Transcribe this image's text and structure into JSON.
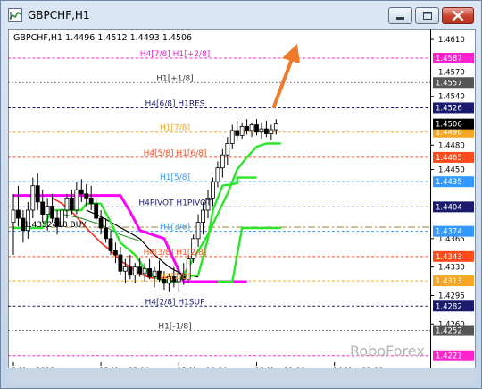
{
  "window": {
    "title": "GBPCHF,H1",
    "header_info": "GBPCHF,H1  1.4496 1.4512 1.4493 1.4506",
    "watermark": "RoboForex",
    "controls": [
      "minimize",
      "maximize",
      "close"
    ]
  },
  "chart_data": {
    "type": "candlestick",
    "symbol": "GBPCHF",
    "timeframe": "H1",
    "ohlc_header": {
      "open": 1.4496,
      "high": 1.4512,
      "low": 1.4493,
      "close": 1.4506
    },
    "ylim": [
      1.4213,
      1.462
    ],
    "price_ticks": [
      1.461,
      1.457,
      1.454,
      1.448,
      1.445,
      1.4365,
      1.433,
      1.4295,
      1.426
    ],
    "price_tick_labels": [
      "1.4610",
      "1.4570",
      "1.4540",
      "1.4480",
      "1.4450",
      "1.4365",
      "1.4330",
      "1.4295",
      "1.4260"
    ],
    "x_tick_labels": [
      "9 Mar 2012",
      "12 Mar 03:00",
      "12 Mar 19:00",
      "13 Mar 11:00",
      "14 Mar 03:00"
    ],
    "x_tick_index": [
      0,
      18,
      34,
      50,
      66
    ],
    "levels": [
      {
        "label": "H4[7/8] H1[+2/8]",
        "price": 1.4587,
        "price_label": "1.4587",
        "color": "#ff22cc",
        "style": "dash",
        "label_color": "#ee22cc"
      },
      {
        "label": "H1[+1/8]",
        "price": 1.4557,
        "price_label": "1.4557",
        "color": "#555555",
        "style": "dot",
        "label_color": "#333333"
      },
      {
        "label": "H4[6/8] H1RES",
        "price": 1.4526,
        "price_label": "1.4526",
        "color": "#1a1a6e",
        "style": "dash",
        "label_color": "#1a1a6e"
      },
      {
        "label": "H1[7/8]",
        "price": 1.4496,
        "price_label": "1.4496",
        "color": "#f5a623",
        "style": "dash",
        "label_color": "#f5a623"
      },
      {
        "label": "H4[5/8] H1[6/8]",
        "price": 1.4465,
        "price_label": "1.4465",
        "color": "#ff4a1c",
        "style": "dash",
        "label_color": "#ff4a1c"
      },
      {
        "label": "H1[5/8]",
        "price": 1.4435,
        "price_label": "1.4435",
        "color": "#3399ff",
        "style": "dash",
        "label_color": "#3399ff"
      },
      {
        "label": "H4PIVOT H1PIVOT",
        "price": 1.4404,
        "price_label": "1.4404",
        "color": "#1a1a6e",
        "style": "dash",
        "label_color": "#1a1a6e"
      },
      {
        "label": "H1[3/8]",
        "price": 1.4374,
        "price_label": "1.4374",
        "color": "#3399ff",
        "style": "dash",
        "label_color": "#3399ff"
      },
      {
        "label": "H4[3/8] H1[2/8]",
        "price": 1.4343,
        "price_label": "1.4343",
        "color": "#ff4a1c",
        "style": "dash",
        "label_color": "#ff4a1c"
      },
      {
        "label": "H1[1/8]",
        "price": 1.4313,
        "price_label": "1.4313",
        "color": "#f5a623",
        "style": "dash",
        "label_color": "#f5a623"
      },
      {
        "label": "H4[2/8] H1SUP",
        "price": 1.4282,
        "price_label": "1.4282",
        "color": "#1a1a6e",
        "style": "dash",
        "label_color": "#1a1a6e"
      },
      {
        "label": "H1[-1/8]",
        "price": 1.4252,
        "price_label": "1.4252",
        "color": "#555555",
        "style": "dot",
        "label_color": "#333333"
      },
      {
        "label": "",
        "price": 1.4221,
        "price_label": "1.4221",
        "color": "#ff22cc",
        "style": "dash",
        "label_color": "#ee22cc"
      }
    ],
    "current_price": {
      "value": 1.4506,
      "label": "1.4506",
      "color": "#000000"
    },
    "ask_line": {
      "price": 1.4379,
      "color": "#b5a26a",
      "style": "dashdot"
    },
    "left_label": {
      "text": "1.4352418 BUY",
      "price": 1.4385
    },
    "candles": [
      {
        "o": 1.4385,
        "h": 1.442,
        "l": 1.4345,
        "c": 1.44
      },
      {
        "o": 1.44,
        "h": 1.443,
        "l": 1.438,
        "c": 1.439
      },
      {
        "o": 1.439,
        "h": 1.44,
        "l": 1.436,
        "c": 1.4375
      },
      {
        "o": 1.4375,
        "h": 1.441,
        "l": 1.4365,
        "c": 1.44
      },
      {
        "o": 1.44,
        "h": 1.444,
        "l": 1.439,
        "c": 1.443
      },
      {
        "o": 1.443,
        "h": 1.4445,
        "l": 1.44,
        "c": 1.441
      },
      {
        "o": 1.441,
        "h": 1.4425,
        "l": 1.4385,
        "c": 1.4395
      },
      {
        "o": 1.4395,
        "h": 1.4415,
        "l": 1.4375,
        "c": 1.4405
      },
      {
        "o": 1.4405,
        "h": 1.442,
        "l": 1.4385,
        "c": 1.439
      },
      {
        "o": 1.439,
        "h": 1.44,
        "l": 1.437,
        "c": 1.438
      },
      {
        "o": 1.438,
        "h": 1.441,
        "l": 1.4375,
        "c": 1.44
      },
      {
        "o": 1.44,
        "h": 1.442,
        "l": 1.439,
        "c": 1.4415
      },
      {
        "o": 1.4415,
        "h": 1.4425,
        "l": 1.4395,
        "c": 1.44
      },
      {
        "o": 1.44,
        "h": 1.4435,
        "l": 1.4395,
        "c": 1.4425
      },
      {
        "o": 1.4425,
        "h": 1.4438,
        "l": 1.441,
        "c": 1.442
      },
      {
        "o": 1.442,
        "h": 1.4432,
        "l": 1.4405,
        "c": 1.4415
      },
      {
        "o": 1.4415,
        "h": 1.443,
        "l": 1.44,
        "c": 1.4408
      },
      {
        "o": 1.4408,
        "h": 1.4415,
        "l": 1.4385,
        "c": 1.439
      },
      {
        "o": 1.439,
        "h": 1.44,
        "l": 1.437,
        "c": 1.4378
      },
      {
        "o": 1.4378,
        "h": 1.439,
        "l": 1.436,
        "c": 1.4365
      },
      {
        "o": 1.4365,
        "h": 1.4375,
        "l": 1.4345,
        "c": 1.435
      },
      {
        "o": 1.435,
        "h": 1.436,
        "l": 1.4335,
        "c": 1.4345
      },
      {
        "o": 1.4345,
        "h": 1.4355,
        "l": 1.432,
        "c": 1.4325
      },
      {
        "o": 1.4325,
        "h": 1.434,
        "l": 1.431,
        "c": 1.433
      },
      {
        "o": 1.433,
        "h": 1.4345,
        "l": 1.4315,
        "c": 1.432
      },
      {
        "o": 1.432,
        "h": 1.4335,
        "l": 1.431,
        "c": 1.433
      },
      {
        "o": 1.433,
        "h": 1.4342,
        "l": 1.4318,
        "c": 1.4322
      },
      {
        "o": 1.4322,
        "h": 1.4335,
        "l": 1.4312,
        "c": 1.4328
      },
      {
        "o": 1.4328,
        "h": 1.434,
        "l": 1.4315,
        "c": 1.4318
      },
      {
        "o": 1.4318,
        "h": 1.433,
        "l": 1.4305,
        "c": 1.4325
      },
      {
        "o": 1.4325,
        "h": 1.4338,
        "l": 1.4312,
        "c": 1.4315
      },
      {
        "o": 1.4315,
        "h": 1.4325,
        "l": 1.4302,
        "c": 1.431
      },
      {
        "o": 1.431,
        "h": 1.4322,
        "l": 1.43,
        "c": 1.4318
      },
      {
        "o": 1.4318,
        "h": 1.433,
        "l": 1.4305,
        "c": 1.4312
      },
      {
        "o": 1.4312,
        "h": 1.4328,
        "l": 1.43,
        "c": 1.4322
      },
      {
        "o": 1.4322,
        "h": 1.4335,
        "l": 1.4308,
        "c": 1.4315
      },
      {
        "o": 1.4315,
        "h": 1.4345,
        "l": 1.431,
        "c": 1.434
      },
      {
        "o": 1.434,
        "h": 1.437,
        "l": 1.4335,
        "c": 1.4365
      },
      {
        "o": 1.4365,
        "h": 1.4395,
        "l": 1.4355,
        "c": 1.4385
      },
      {
        "o": 1.4385,
        "h": 1.441,
        "l": 1.437,
        "c": 1.44
      },
      {
        "o": 1.44,
        "h": 1.4425,
        "l": 1.439,
        "c": 1.4415
      },
      {
        "o": 1.4415,
        "h": 1.444,
        "l": 1.4405,
        "c": 1.4435
      },
      {
        "o": 1.4435,
        "h": 1.446,
        "l": 1.4428,
        "c": 1.4452
      },
      {
        "o": 1.4452,
        "h": 1.4475,
        "l": 1.444,
        "c": 1.4468
      },
      {
        "o": 1.4468,
        "h": 1.449,
        "l": 1.4455,
        "c": 1.4482
      },
      {
        "o": 1.4482,
        "h": 1.4505,
        "l": 1.4475,
        "c": 1.4498
      },
      {
        "o": 1.4498,
        "h": 1.451,
        "l": 1.4485,
        "c": 1.4492
      },
      {
        "o": 1.4492,
        "h": 1.4508,
        "l": 1.4488,
        "c": 1.4503
      },
      {
        "o": 1.4503,
        "h": 1.4512,
        "l": 1.4493,
        "c": 1.4498
      },
      {
        "o": 1.4498,
        "h": 1.4508,
        "l": 1.449,
        "c": 1.4505
      },
      {
        "o": 1.4505,
        "h": 1.4512,
        "l": 1.4492,
        "c": 1.4496
      },
      {
        "o": 1.4496,
        "h": 1.4508,
        "l": 1.4488,
        "c": 1.45
      },
      {
        "o": 1.45,
        "h": 1.451,
        "l": 1.449,
        "c": 1.4494
      },
      {
        "o": 1.4494,
        "h": 1.4505,
        "l": 1.4486,
        "c": 1.4499
      },
      {
        "o": 1.4499,
        "h": 1.4512,
        "l": 1.4493,
        "c": 1.4506
      }
    ],
    "indicators": [
      {
        "name": "",
        "color": "#ff00ff",
        "width": 3,
        "points": [
          [
            0,
            1.4418
          ],
          [
            22,
            1.4418
          ],
          [
            24,
            1.4398
          ],
          [
            26,
            1.4375
          ],
          [
            31,
            1.4365
          ],
          [
            35,
            1.4312
          ],
          [
            48,
            1.4312
          ]
        ]
      },
      {
        "name": "",
        "color": "#ff2a1c",
        "width": 1.6,
        "points": [
          [
            8,
            1.4415
          ],
          [
            10,
            1.4408
          ],
          [
            12,
            1.4398
          ],
          [
            14,
            1.4385
          ],
          [
            16,
            1.4372
          ],
          [
            18,
            1.436
          ],
          [
            20,
            1.435
          ],
          [
            22,
            1.4338
          ],
          [
            24,
            1.433
          ],
          [
            26,
            1.4322
          ],
          [
            28,
            1.4317
          ],
          [
            30,
            1.4316
          ],
          [
            32,
            1.4318
          ]
        ]
      },
      {
        "name": "",
        "color": "#000000",
        "width": 1.2,
        "points": [
          [
            15,
            1.44
          ],
          [
            18,
            1.4392
          ],
          [
            21,
            1.4382
          ],
          [
            24,
            1.4372
          ],
          [
            26,
            1.4365
          ],
          [
            29,
            1.4345
          ],
          [
            32,
            1.433
          ],
          [
            35,
            1.432
          ],
          [
            38,
            1.4318
          ]
        ]
      },
      {
        "name": "",
        "color": "#1e8a1e",
        "width": 1,
        "points": [
          [
            10,
            1.4395
          ],
          [
            14,
            1.439
          ],
          [
            18,
            1.4382
          ],
          [
            22,
            1.437
          ],
          [
            26,
            1.4362
          ],
          [
            30,
            1.4362
          ],
          [
            34,
            1.4362
          ]
        ]
      },
      {
        "name": "",
        "color": "#2ae62a",
        "width": 2.4,
        "points": [
          [
            0,
            1.4378
          ],
          [
            6,
            1.4378
          ],
          [
            8,
            1.44
          ],
          [
            14,
            1.44
          ],
          [
            15,
            1.4408
          ],
          [
            18,
            1.4408
          ],
          [
            20,
            1.4385
          ],
          [
            22,
            1.436
          ],
          [
            25,
            1.4345
          ],
          [
            27,
            1.4328
          ],
          [
            29,
            1.4318
          ],
          [
            31,
            1.4312
          ],
          [
            34,
            1.4312
          ],
          [
            36,
            1.433
          ],
          [
            38,
            1.435
          ],
          [
            40,
            1.437
          ],
          [
            42,
            1.4395
          ],
          [
            44,
            1.442
          ],
          [
            46,
            1.445
          ],
          [
            48,
            1.4465
          ],
          [
            50,
            1.4478
          ],
          [
            52,
            1.4482
          ],
          [
            55,
            1.4482
          ]
        ]
      },
      {
        "name": "",
        "color": "#2ae62a",
        "width": 2.4,
        "points": [
          [
            35,
            1.4318
          ],
          [
            38,
            1.432
          ],
          [
            40,
            1.4365
          ],
          [
            41,
            1.44
          ],
          [
            43,
            1.443
          ],
          [
            46,
            1.4433
          ],
          [
            46,
            1.444
          ],
          [
            50,
            1.444
          ]
        ]
      },
      {
        "name": "",
        "color": "#2ae62a",
        "width": 2.4,
        "points": [
          [
            42,
            1.4312
          ],
          [
            45,
            1.4312
          ],
          [
            46,
            1.4345
          ],
          [
            47,
            1.4378
          ],
          [
            55,
            1.4378
          ]
        ]
      }
    ]
  }
}
